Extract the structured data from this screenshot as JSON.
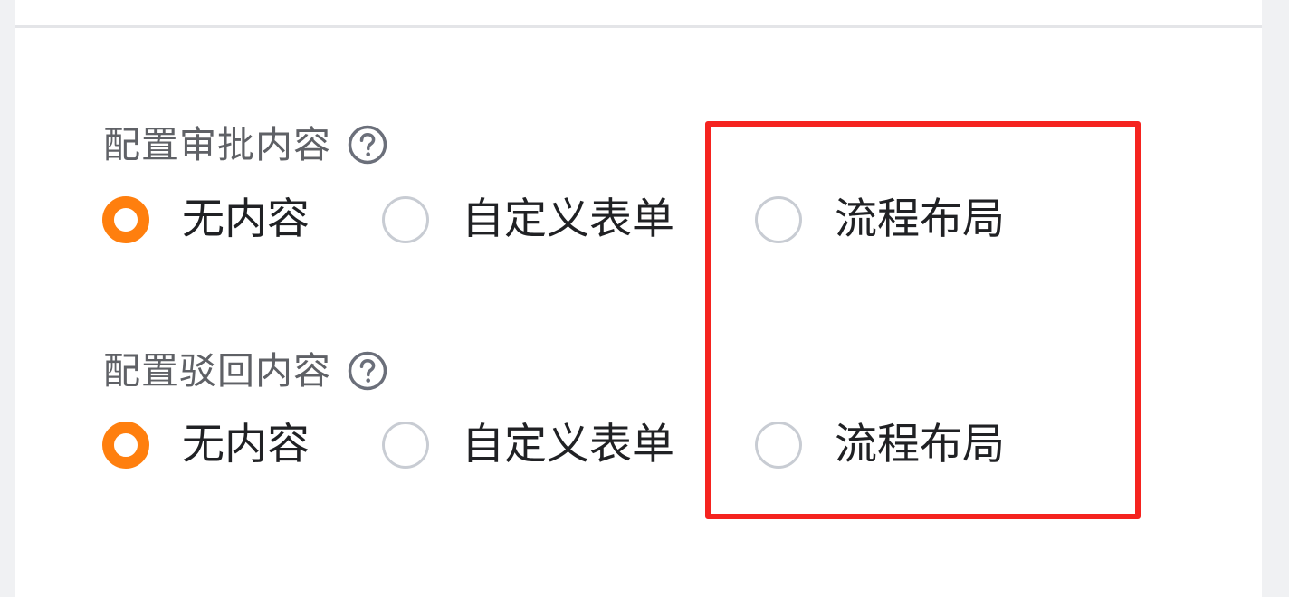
{
  "sections": [
    {
      "label": "配置审批内容",
      "help_icon": "question-circle-icon",
      "options": [
        {
          "label": "无内容",
          "selected": true
        },
        {
          "label": "自定义表单",
          "selected": false
        },
        {
          "label": "流程布局",
          "selected": false
        }
      ]
    },
    {
      "label": "配置驳回内容",
      "help_icon": "question-circle-icon",
      "options": [
        {
          "label": "无内容",
          "selected": true
        },
        {
          "label": "自定义表单",
          "selected": false
        },
        {
          "label": "流程布局",
          "selected": false
        }
      ]
    }
  ],
  "colors": {
    "accent": "#ff7f0e",
    "highlight": "#f5231f",
    "label_text": "#5f6166",
    "option_text": "#202124",
    "unchecked_border": "#c8ccd3"
  }
}
